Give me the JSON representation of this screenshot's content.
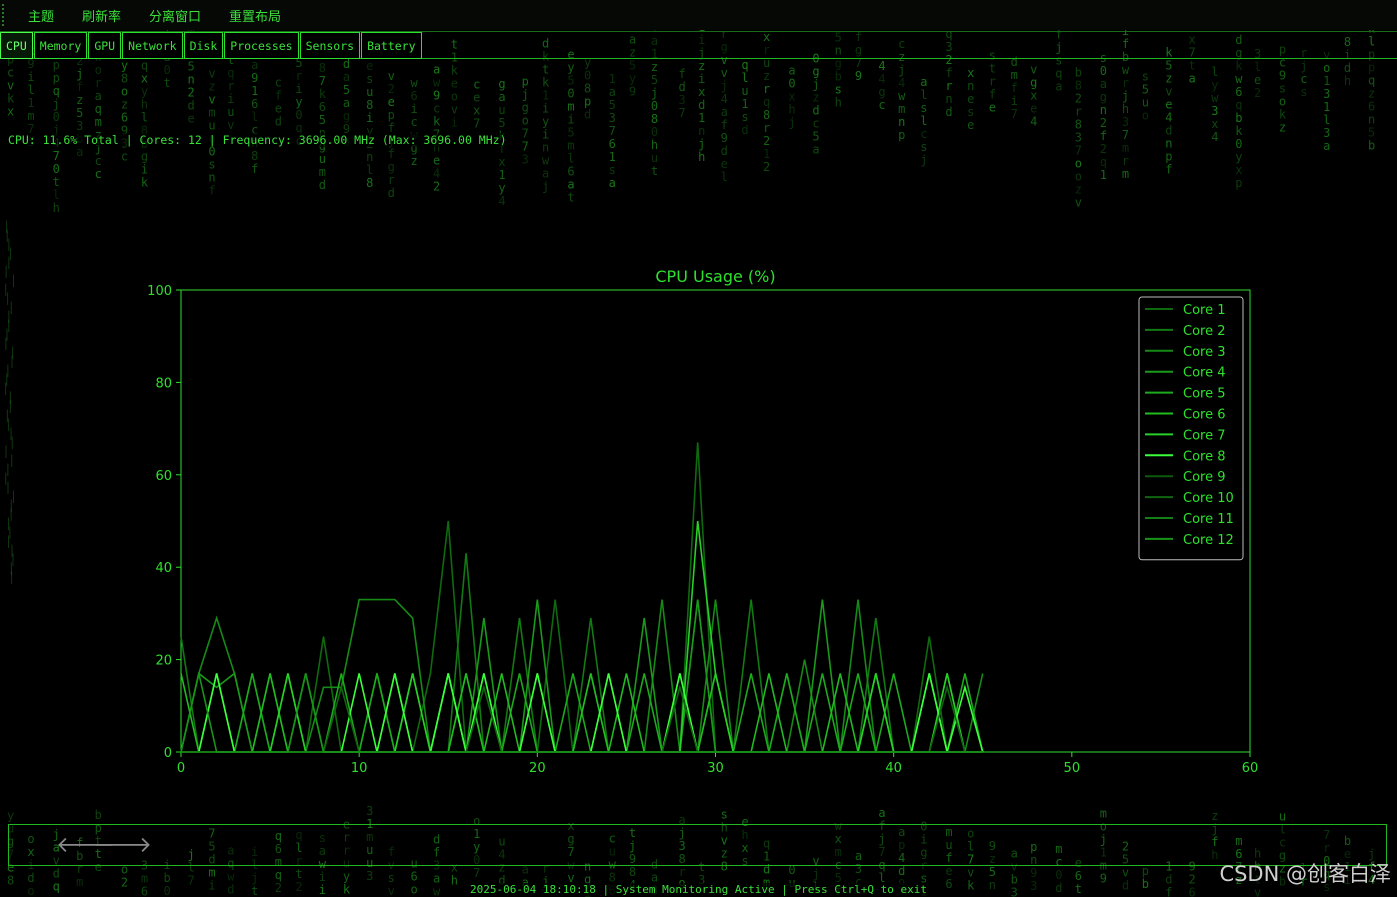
{
  "menubar": {
    "items": [
      "主题",
      "刷新率",
      "分离窗口",
      "重置布局"
    ]
  },
  "tabs": [
    {
      "label": "CPU",
      "active": true
    },
    {
      "label": "Memory",
      "active": false
    },
    {
      "label": "GPU",
      "active": false
    },
    {
      "label": "Network",
      "active": false
    },
    {
      "label": "Disk",
      "active": false
    },
    {
      "label": "Processes",
      "active": false
    },
    {
      "label": "Sensors",
      "active": false
    },
    {
      "label": "Battery",
      "active": false
    }
  ],
  "cpu_info": "CPU: 11.6% Total | Cores: 12 | Frequency: 3696.00 MHz (Max: 3696.00 MHz)",
  "status": {
    "text": "2025-06-04 18:10:18 | System Monitoring Active | Press Ctrl+Q to exit"
  },
  "watermark": "CSDN @创客白泽",
  "nav": {
    "back_icon": "arrow-left-icon",
    "forward_icon": "arrow-right-icon"
  },
  "colors": {
    "accent": "#2ee02e",
    "background": "#000000"
  },
  "chart_data": {
    "type": "line",
    "title": "CPU Usage (%)",
    "xlabel": "",
    "ylabel": "",
    "xlim": [
      0,
      60
    ],
    "ylim": [
      0,
      100
    ],
    "xticks": [
      0,
      10,
      20,
      30,
      40,
      50,
      60
    ],
    "yticks": [
      0,
      20,
      40,
      60,
      80,
      100
    ],
    "grid": false,
    "legend": "top-right",
    "x": [
      0,
      1,
      2,
      3,
      4,
      5,
      6,
      7,
      8,
      9,
      10,
      11,
      12,
      13,
      14,
      15,
      16,
      17,
      18,
      19,
      20,
      21,
      22,
      23,
      24,
      25,
      26,
      27,
      28,
      29,
      30,
      31,
      32,
      33,
      34,
      35,
      36,
      37,
      38,
      39,
      40,
      41,
      42,
      43,
      44,
      45
    ],
    "series": [
      {
        "name": "Core 1",
        "color": "#0f6a0f",
        "values": [
          0,
          0,
          17,
          0,
          0,
          17,
          0,
          0,
          25,
          0,
          0,
          0,
          0,
          0,
          17,
          50,
          0,
          0,
          0,
          0,
          0,
          33,
          0,
          0,
          0,
          0,
          0,
          0,
          0,
          67,
          0,
          0,
          0,
          0,
          17,
          0,
          0,
          0,
          0,
          17,
          0,
          0,
          25,
          0,
          0,
          0
        ]
      },
      {
        "name": "Core 2",
        "color": "#127a12",
        "values": [
          25,
          0,
          0,
          0,
          17,
          0,
          0,
          0,
          0,
          0,
          0,
          0,
          0,
          0,
          0,
          0,
          43,
          0,
          0,
          29,
          0,
          0,
          0,
          29,
          0,
          0,
          0,
          0,
          0,
          33,
          0,
          0,
          33,
          0,
          0,
          0,
          0,
          0,
          0,
          29,
          0,
          0,
          0,
          0,
          0,
          0
        ]
      },
      {
        "name": "Core 3",
        "color": "#168a16",
        "values": [
          0,
          17,
          29,
          17,
          0,
          0,
          0,
          0,
          14,
          14,
          33,
          33,
          33,
          29,
          0,
          0,
          17,
          0,
          0,
          0,
          0,
          0,
          0,
          17,
          0,
          0,
          0,
          33,
          0,
          0,
          33,
          0,
          0,
          0,
          0,
          20,
          0,
          0,
          33,
          0,
          0,
          0,
          0,
          0,
          0,
          17
        ]
      },
      {
        "name": "Core 4",
        "color": "#1a9a1a",
        "values": [
          0,
          17,
          14,
          17,
          0,
          0,
          0,
          0,
          0,
          0,
          0,
          17,
          0,
          0,
          0,
          17,
          0,
          29,
          0,
          0,
          33,
          0,
          0,
          0,
          0,
          0,
          29,
          0,
          0,
          33,
          0,
          0,
          0,
          0,
          0,
          0,
          33,
          0,
          0,
          0,
          0,
          0,
          0,
          17,
          0,
          0
        ]
      },
      {
        "name": "Core 5",
        "color": "#1daa1d",
        "values": [
          0,
          0,
          17,
          0,
          17,
          0,
          17,
          0,
          0,
          17,
          0,
          17,
          0,
          17,
          0,
          17,
          0,
          17,
          0,
          17,
          0,
          0,
          17,
          0,
          17,
          0,
          17,
          0,
          17,
          0,
          17,
          0,
          17,
          0,
          17,
          0,
          17,
          0,
          17,
          0,
          17,
          0,
          17,
          0,
          17,
          0
        ]
      },
      {
        "name": "Core 6",
        "color": "#22bb22",
        "values": [
          17,
          0,
          0,
          0,
          0,
          17,
          0,
          17,
          0,
          0,
          0,
          0,
          17,
          0,
          0,
          0,
          17,
          0,
          17,
          0,
          0,
          0,
          0,
          17,
          0,
          17,
          0,
          0,
          0,
          0,
          17,
          0,
          0,
          17,
          0,
          0,
          0,
          17,
          0,
          17,
          0,
          0,
          17,
          0,
          0,
          0
        ]
      },
      {
        "name": "Core 7",
        "color": "#28d028",
        "values": [
          0,
          0,
          0,
          0,
          0,
          0,
          17,
          0,
          0,
          0,
          0,
          0,
          0,
          17,
          0,
          17,
          0,
          0,
          0,
          0,
          17,
          0,
          0,
          0,
          0,
          0,
          0,
          0,
          0,
          50,
          17,
          0,
          0,
          0,
          0,
          0,
          0,
          0,
          0,
          17,
          0,
          0,
          0,
          17,
          0,
          0
        ]
      },
      {
        "name": "Core 8",
        "color": "#3cff3c",
        "values": [
          0,
          0,
          17,
          0,
          0,
          0,
          0,
          0,
          0,
          0,
          17,
          0,
          17,
          0,
          0,
          17,
          0,
          17,
          0,
          0,
          17,
          0,
          0,
          0,
          17,
          0,
          0,
          0,
          17,
          0,
          0,
          0,
          0,
          0,
          0,
          0,
          0,
          0,
          0,
          0,
          0,
          0,
          17,
          0,
          14,
          0
        ]
      },
      {
        "name": "Core 9",
        "color": "#0d5a0d",
        "values": [
          0,
          0,
          0,
          0,
          0,
          0,
          0,
          0,
          0,
          0,
          0,
          0,
          0,
          0,
          0,
          0,
          0,
          0,
          0,
          0,
          0,
          0,
          0,
          0,
          0,
          0,
          0,
          0,
          0,
          0,
          0,
          0,
          0,
          0,
          0,
          0,
          0,
          0,
          0,
          0,
          0,
          0,
          0,
          0,
          0,
          0
        ]
      },
      {
        "name": "Core 10",
        "color": "#0f660f",
        "values": [
          0,
          0,
          0,
          0,
          0,
          0,
          0,
          0,
          0,
          14,
          0,
          0,
          0,
          0,
          0,
          0,
          0,
          14,
          0,
          0,
          0,
          0,
          0,
          0,
          0,
          0,
          0,
          0,
          14,
          0,
          0,
          0,
          0,
          0,
          0,
          0,
          0,
          0,
          0,
          0,
          0,
          0,
          0,
          14,
          0,
          0
        ]
      },
      {
        "name": "Core 11",
        "color": "#138013",
        "values": [
          0,
          0,
          0,
          0,
          0,
          0,
          0,
          0,
          0,
          0,
          0,
          0,
          0,
          0,
          0,
          0,
          0,
          0,
          0,
          0,
          0,
          0,
          0,
          0,
          0,
          0,
          0,
          0,
          0,
          0,
          0,
          0,
          0,
          0,
          0,
          0,
          0,
          0,
          0,
          0,
          0,
          0,
          0,
          0,
          0,
          0
        ]
      },
      {
        "name": "Core 12",
        "color": "#189418",
        "values": [
          0,
          17,
          0,
          0,
          0,
          0,
          0,
          17,
          0,
          0,
          0,
          0,
          0,
          0,
          0,
          0,
          0,
          0,
          0,
          0,
          0,
          0,
          0,
          0,
          0,
          0,
          0,
          0,
          0,
          0,
          0,
          0,
          0,
          0,
          0,
          0,
          0,
          0,
          0,
          0,
          0,
          0,
          0,
          0,
          0,
          0
        ]
      }
    ]
  }
}
